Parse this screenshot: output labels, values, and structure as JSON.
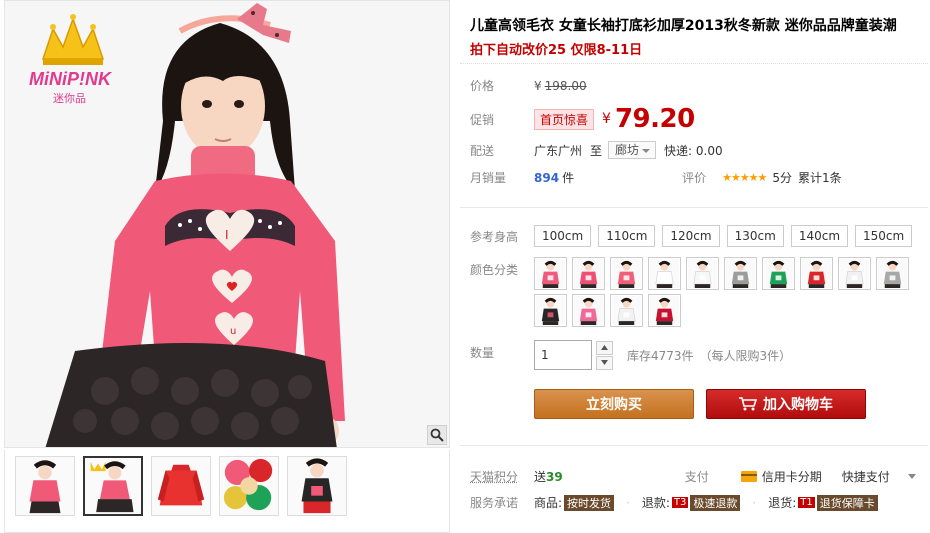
{
  "brand": {
    "logo_text": "MiNiP!NK",
    "logo_sub": "迷你品"
  },
  "product": {
    "title": "儿童高领毛衣 女童长袖打底衫加厚2013秋冬新款 迷你品品牌童装潮",
    "promo_line": "拍下自动改价25 仅限8-11日"
  },
  "price": {
    "label": "价格",
    "currency": "¥",
    "original": "198.00"
  },
  "promo": {
    "label": "促销",
    "badge": "首页惊喜",
    "currency": "¥",
    "value": "79.20"
  },
  "shipping": {
    "label": "配送",
    "from": "广东广州",
    "to_word": "至",
    "destination": "廊坊",
    "express": "快递: 0.00"
  },
  "sales": {
    "label": "月销量",
    "count": "894",
    "unit": "件"
  },
  "rating": {
    "label": "评价",
    "stars": "★★★★★",
    "score": "5分",
    "total": "累计1条"
  },
  "sizes": {
    "label": "参考身高",
    "options": [
      "100cm",
      "110cm",
      "120cm",
      "130cm",
      "140cm",
      "150cm"
    ]
  },
  "colors": {
    "label": "颜色分类",
    "swatches": [
      "#f05a7a",
      "#ee4f72",
      "#f06078",
      "#ffffff",
      "#f7f7f7",
      "#9c9c9c",
      "#1ea257",
      "#d9262b",
      "#f1f1f1",
      "#a8a8a8",
      "#262626",
      "#ef6a98",
      "#f2f2f2",
      "#c8102e"
    ]
  },
  "quantity": {
    "label": "数量",
    "value": "1",
    "stock": "库存4773件",
    "limit": "（每人限购3件）"
  },
  "actions": {
    "buy_now": "立刻购买",
    "add_cart": "加入购物车"
  },
  "points": {
    "label": "天猫积分",
    "value_prefix": "送",
    "value": "39"
  },
  "payment": {
    "label": "支付",
    "credit": "信用卡分期",
    "quick": "快捷支付"
  },
  "service": {
    "label": "服务承诺",
    "goods": "商品:",
    "goods_tag": "按时发货",
    "refund": "退款:",
    "refund_t": "T3",
    "refund_tag": "极速退款",
    "return": "退货:",
    "return_t": "T1",
    "return_tag": "退货保障卡"
  },
  "colors_theme": {
    "price_red": "#c40000",
    "buy_orange": "#c4711f",
    "cart_red": "#b10c0c",
    "sweater_pink": "#f05a78"
  }
}
